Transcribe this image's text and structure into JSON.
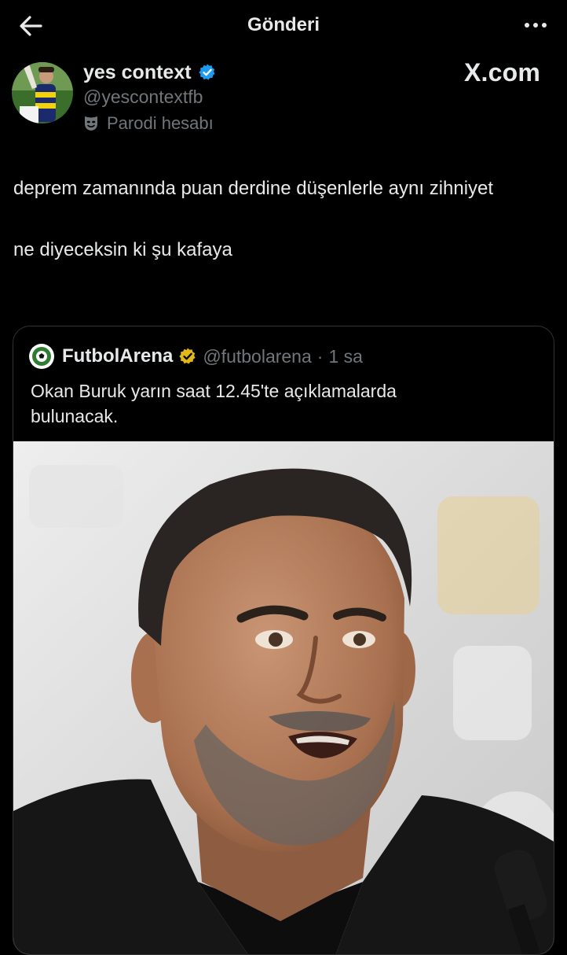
{
  "header": {
    "title": "Gönderi"
  },
  "icons": {
    "back": "arrow-left-icon",
    "more": "more-horizontal-icon",
    "verified": "verified-badge-icon",
    "parody": "parody-mask-icon"
  },
  "colors": {
    "background": "#000000",
    "text": "#e7e9ea",
    "muted": "#71767b",
    "verified_blue": "#1d9bf0",
    "verified_gold": "#e2b719",
    "border": "#2f3336"
  },
  "author": {
    "name": "yes context",
    "handle": "@yescontextfb",
    "label": "Parodi hesabı"
  },
  "watermark": "X.com",
  "post": {
    "paragraphs": [
      "deprem zamanında puan derdine düşenlerle aynı zihniyet",
      "ne diyeceksin ki şu kafaya"
    ]
  },
  "quoted": {
    "name": "FutbolArena",
    "handle": "@futbolarena",
    "separator": "·",
    "time": "1 sa",
    "text": "Okan Buruk yarın saat 12.45'te açıklamalarda bulunacak."
  }
}
